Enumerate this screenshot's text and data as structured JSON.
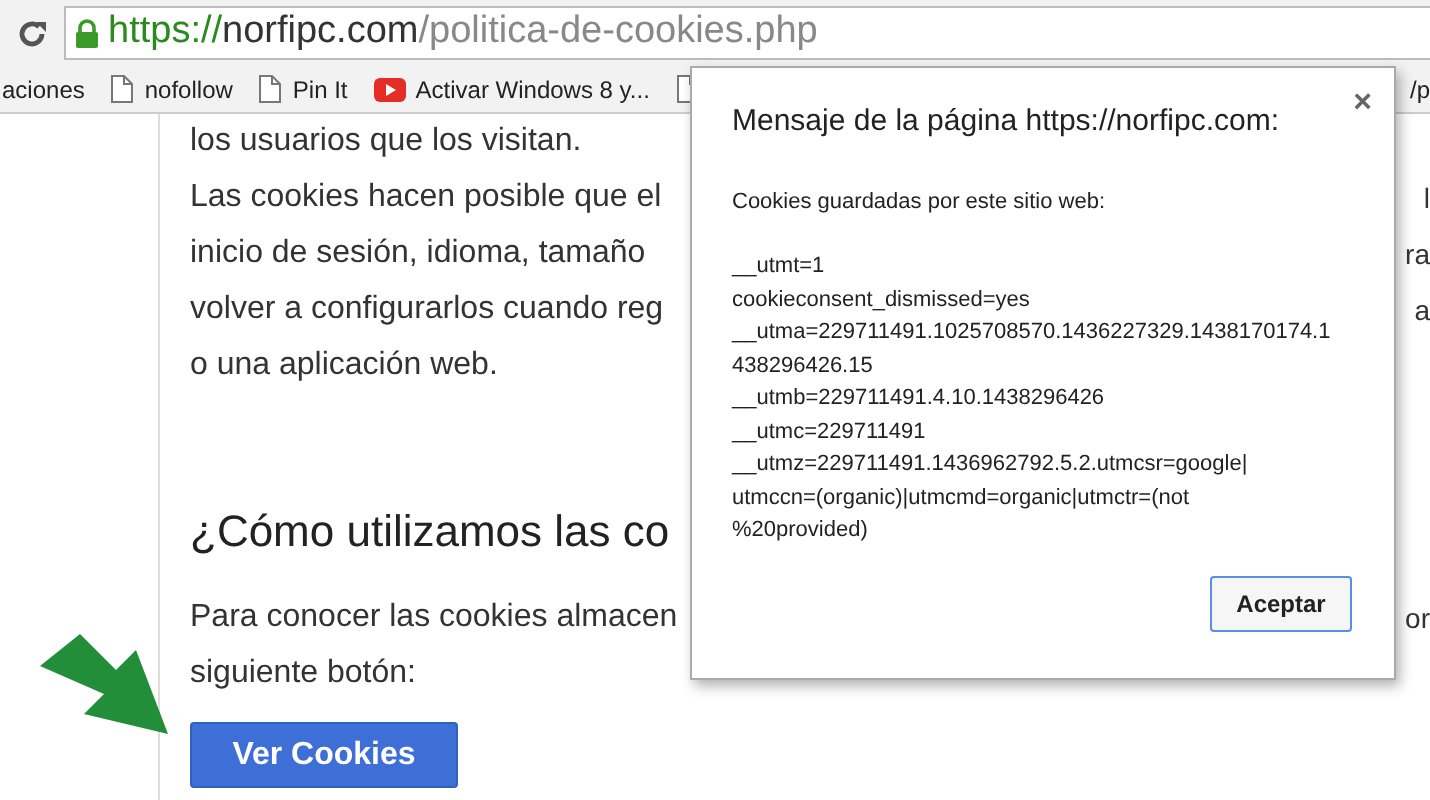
{
  "browser": {
    "url": {
      "scheme": "https://",
      "host": "norfipc.com",
      "path": "/politica-de-cookies.php"
    },
    "bookmarks": [
      {
        "kind": "text",
        "label": "aciones"
      },
      {
        "kind": "page",
        "label": "nofollow"
      },
      {
        "kind": "page",
        "label": "Pin It"
      },
      {
        "kind": "video",
        "label": "Activar Windows 8 y..."
      },
      {
        "kind": "page"
      }
    ],
    "bookmark_tail": "/p"
  },
  "page": {
    "rows": [
      {
        "kind": "text",
        "text": "los usuarios que los visitan."
      },
      {
        "kind": "text",
        "text": "Las cookies hacen posible que el",
        "tail": "l"
      },
      {
        "kind": "text",
        "text": "inicio de sesión, idioma, tamaño",
        "tail": "ra"
      },
      {
        "kind": "text",
        "text": "volver a configurarlos cuando reg",
        "tail": "a"
      },
      {
        "kind": "text",
        "text": "o una aplicación web."
      },
      {
        "kind": "heading",
        "text": "¿Cómo utilizamos las co"
      },
      {
        "kind": "text",
        "text": "Para conocer las cookies almacen",
        "tail": "or"
      },
      {
        "kind": "text",
        "text": "siguiente botón:"
      }
    ],
    "button": "Ver Cookies"
  },
  "dialog": {
    "title": "Mensaje de la página https://norfipc.com:",
    "close": "×",
    "intro": "Cookies guardadas por este sitio web:",
    "lines": [
      "__utmt=1",
      "cookieconsent_dismissed=yes",
      "__utma=229711491.1025708570.1436227329.1438170174.1",
      "438296426.15",
      "__utmb=229711491.4.10.1438296426",
      "__utmc=229711491",
      "__utmz=229711491.1436962792.5.2.utmcsr=google|",
      "utmccn=(organic)|utmcmd=organic|utmctr=(not",
      "%20provided)"
    ],
    "button": "Aceptar"
  }
}
